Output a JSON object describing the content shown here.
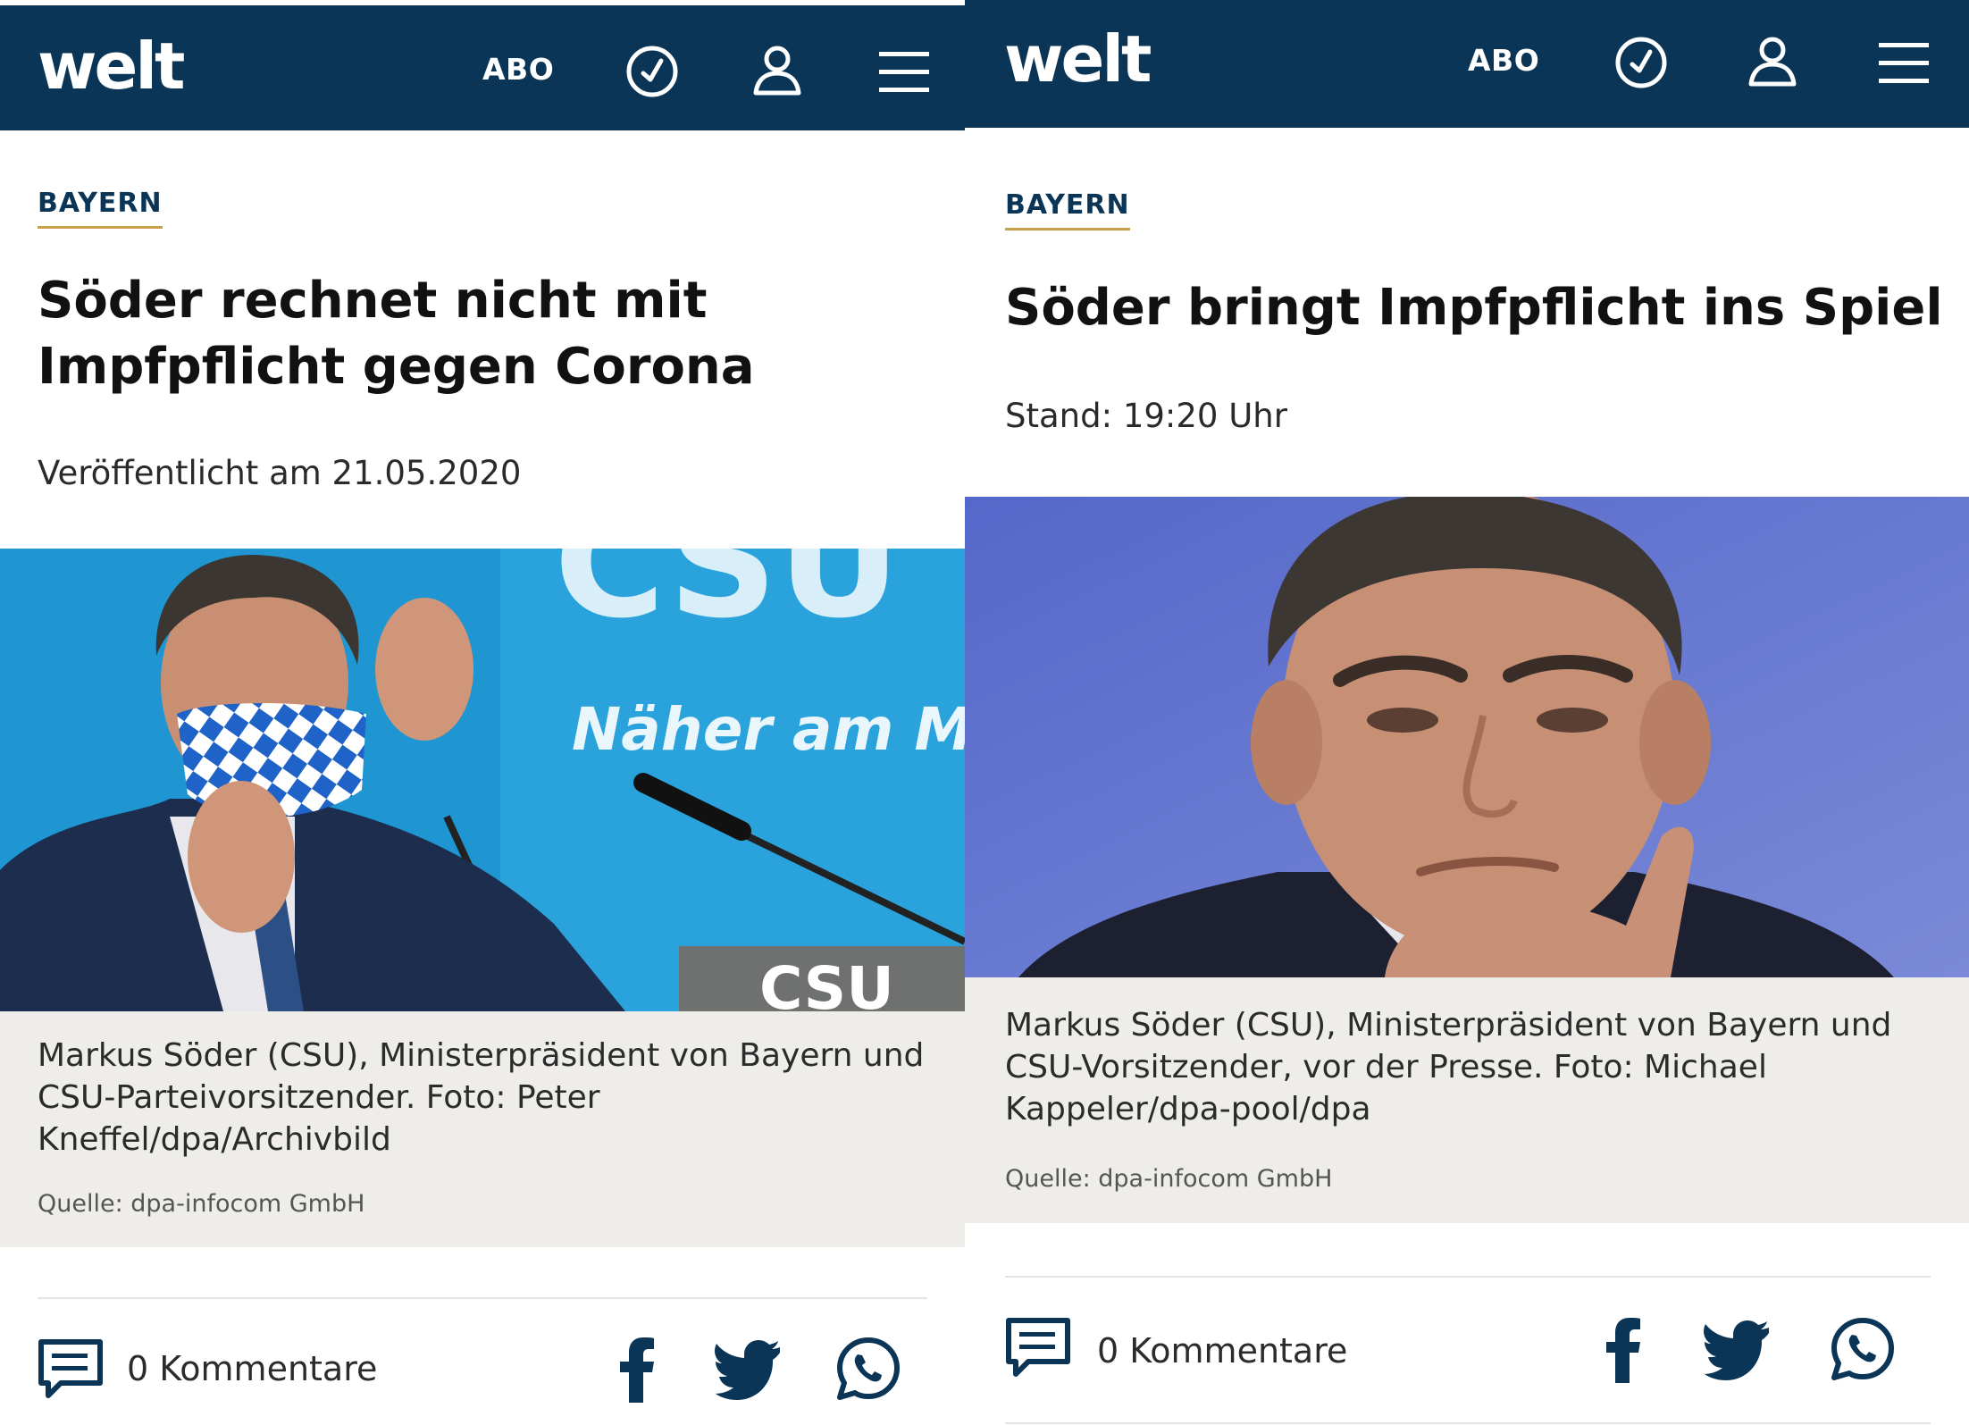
{
  "left": {
    "header": {
      "logo": "welt",
      "abo": "ABO"
    },
    "kicker": "BAYERN",
    "headline": "Söder rechnet nicht mit Impfpflicht gegen Corona",
    "stamp": "Veröffentlicht am 21.05.2020",
    "photo": {
      "backdrop_text": "CSU",
      "slogan": "Näher am Men",
      "lectern_text": "CSU"
    },
    "caption": "Markus Söder (CSU), Ministerpräsident von Bayern und CSU-Parteivorsitzender. Foto: Peter Kneffel/dpa/Archivbild",
    "source": "Quelle: dpa-infocom GmbH",
    "comments": "0 Kommentare",
    "icons": [
      "clock-icon",
      "user-icon",
      "menu-icon",
      "comment-icon",
      "facebook-icon",
      "twitter-icon",
      "whatsapp-icon"
    ]
  },
  "right": {
    "header": {
      "logo": "welt",
      "abo": "ABO"
    },
    "kicker": "BAYERN",
    "headline": "Söder bringt Impfpflicht ins Spiel",
    "stamp": "Stand: 19:20 Uhr",
    "caption": "Markus Söder (CSU), Ministerpräsident von Bayern und CSU-Vorsitzender, vor der Presse. Foto: Michael Kappeler/dpa-pool/dpa",
    "source": "Quelle: dpa-infocom GmbH",
    "comments": "0 Kommentare",
    "icons": [
      "clock-icon",
      "user-icon",
      "menu-icon",
      "comment-icon",
      "facebook-icon",
      "twitter-icon",
      "whatsapp-icon"
    ]
  },
  "colors": {
    "header_bg": "#0a3556",
    "kicker": "#0a3556",
    "kicker_underline": "#c8a04a",
    "caption_bg": "#eeedea"
  }
}
